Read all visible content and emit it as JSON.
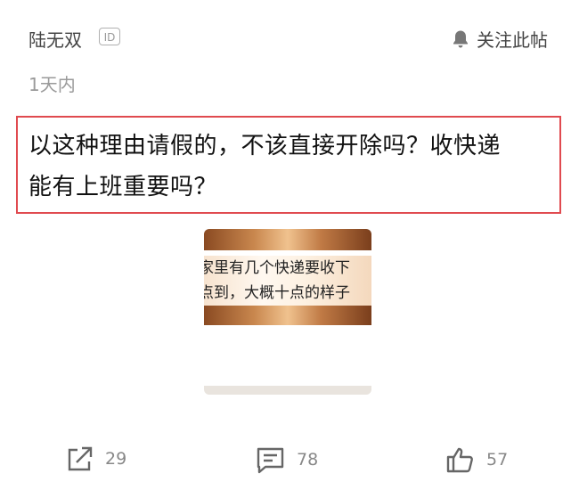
{
  "header": {
    "author": "陆无双",
    "id_badge": "ID",
    "follow_label": "关注此帖",
    "time": "1天内"
  },
  "question": {
    "line1": "以这种理由请假的，不该直接开除吗？收快递",
    "line2": "能有上班重要吗？"
  },
  "image": {
    "line1": "家里有几个快递要收下",
    "line2": "点到，大概十点的样子"
  },
  "actions": {
    "share_count": "29",
    "comment_count": "78",
    "like_count": "57"
  },
  "colors": {
    "highlight_border": "#e04a4f",
    "muted_text": "#888888"
  }
}
